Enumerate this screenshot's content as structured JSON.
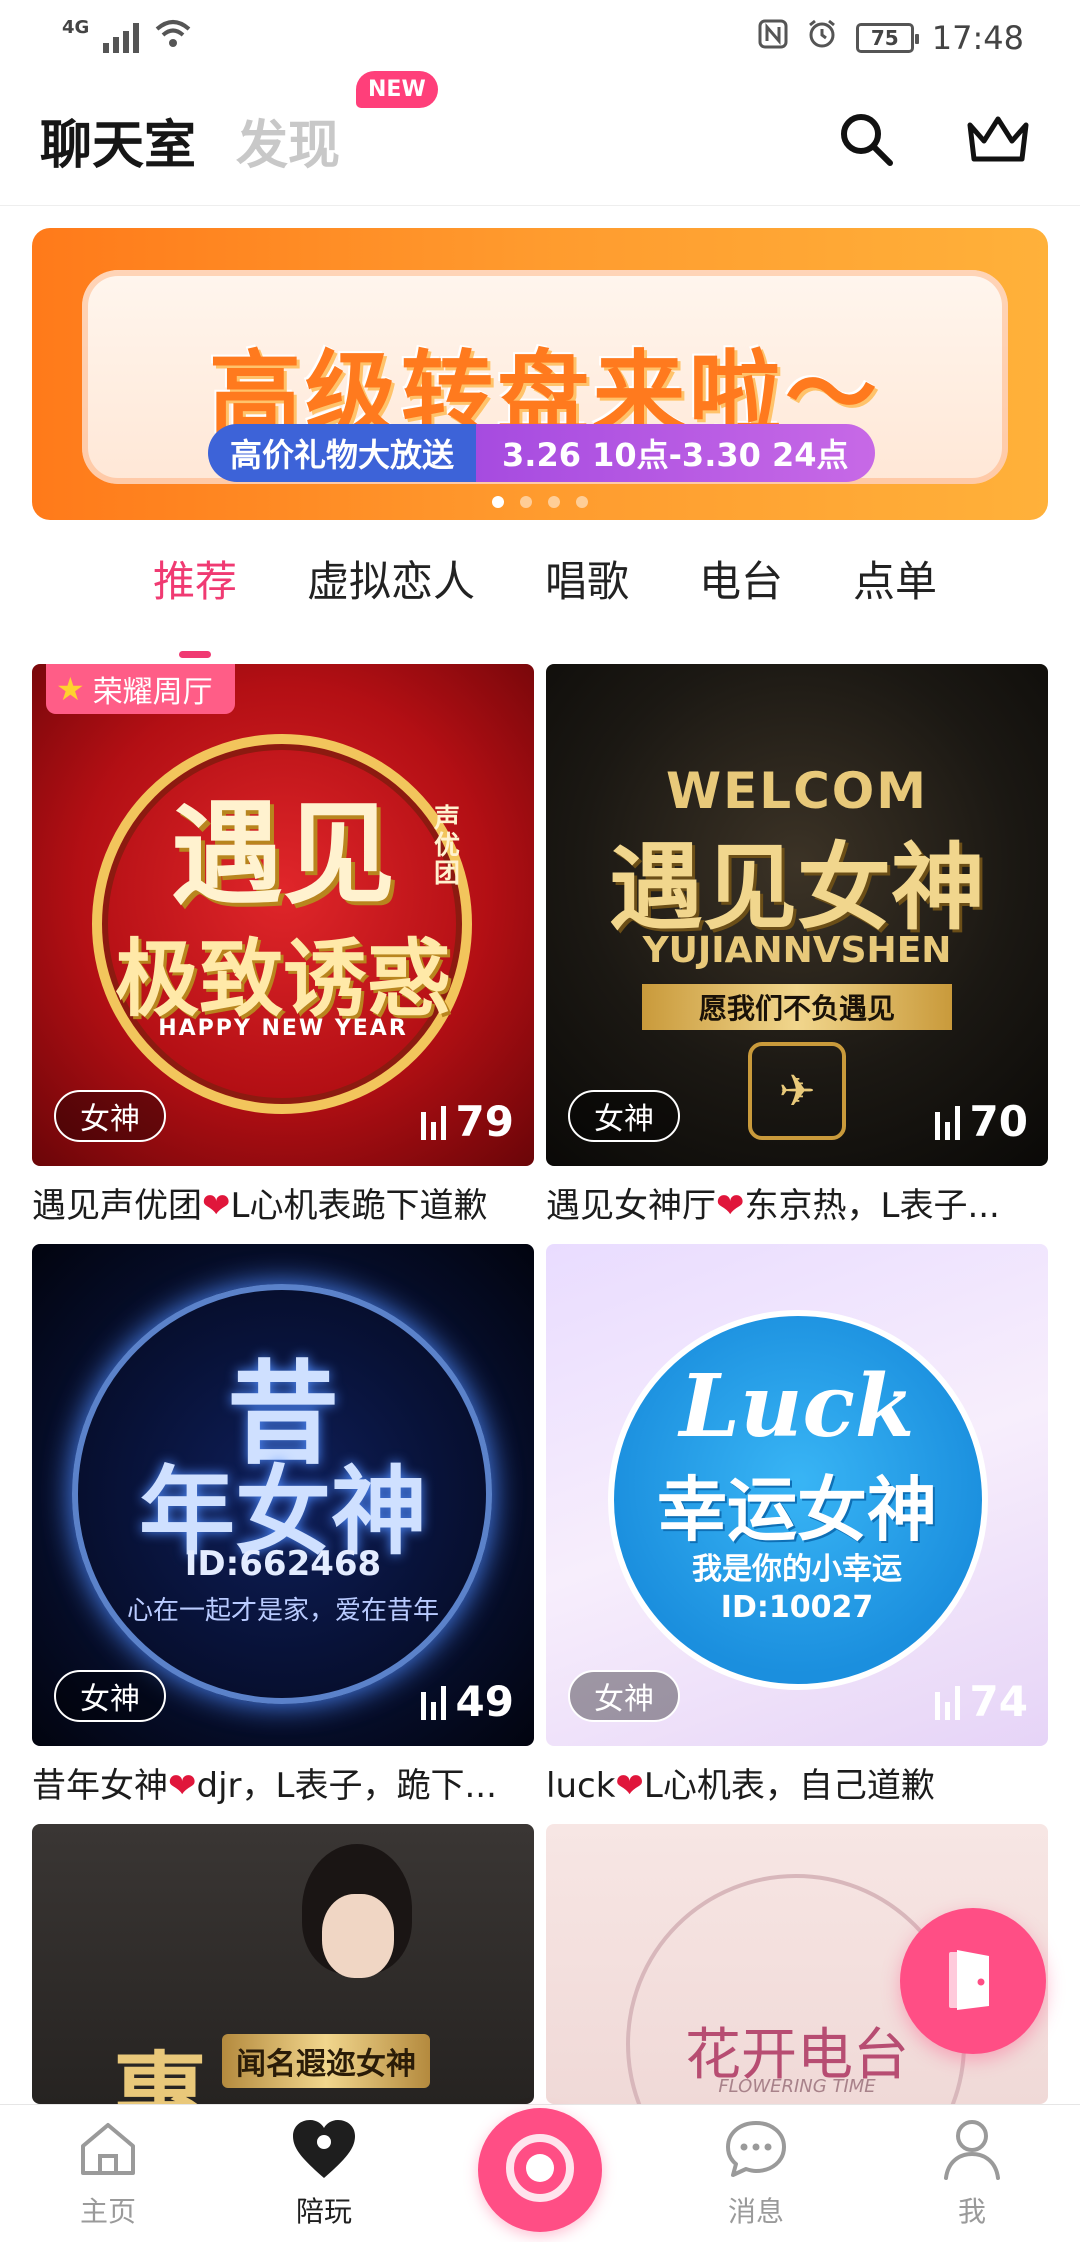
{
  "status_bar": {
    "network": "4G",
    "battery": "75",
    "time": "17:48"
  },
  "header": {
    "tab_chatroom": "聊天室",
    "tab_discover": "发现",
    "new_badge": "NEW"
  },
  "banner": {
    "title": "高级转盘来啦～",
    "pill_left": "高价礼物大放送",
    "pill_right": "3.26 10点-3.30 24点",
    "slides": 4,
    "active_slide": 0
  },
  "categories": [
    "推荐",
    "虚拟恋人",
    "唱歌",
    "电台",
    "点单"
  ],
  "rooms": [
    {
      "honor": "荣耀周厅",
      "tag": "女神",
      "count": "79",
      "title": "遇见声优团❤L心机表跪下道歉",
      "art": {
        "line1": "遇见",
        "side": "声优团",
        "line2": "极致诱惑",
        "sub": "HAPPY NEW YEAR"
      }
    },
    {
      "tag": "女神",
      "count": "70",
      "title": "遇见女神厅❤东京热，L表子...",
      "art": {
        "top": "WELCOM",
        "line1": "遇见女神",
        "roman": "YUJIANNVSHEN",
        "sub": "愿我们不负遇见"
      }
    },
    {
      "tag": "女神",
      "count": "49",
      "title": "昔年女神❤djr，L表子，跪下...",
      "art": {
        "line1": "昔",
        "line2": "年女神",
        "id": "ID:662468",
        "sub": "心在一起才是家，爱在昔年"
      }
    },
    {
      "tag": "女神",
      "count": "74",
      "title": "luck❤L心机表，自己道歉",
      "art": {
        "script": "Luck",
        "line1": "幸运女神",
        "sub": "我是你的小幸运",
        "id": "ID:10027"
      }
    },
    {
      "art": {
        "big": "惠",
        "line1": "闻名遐迩女神"
      }
    },
    {
      "art": {
        "line1": "花开电台",
        "script": "FLOWERING TIME"
      }
    }
  ],
  "bottom_nav": {
    "home": "主页",
    "play": "陪玩",
    "message": "消息",
    "me": "我"
  }
}
